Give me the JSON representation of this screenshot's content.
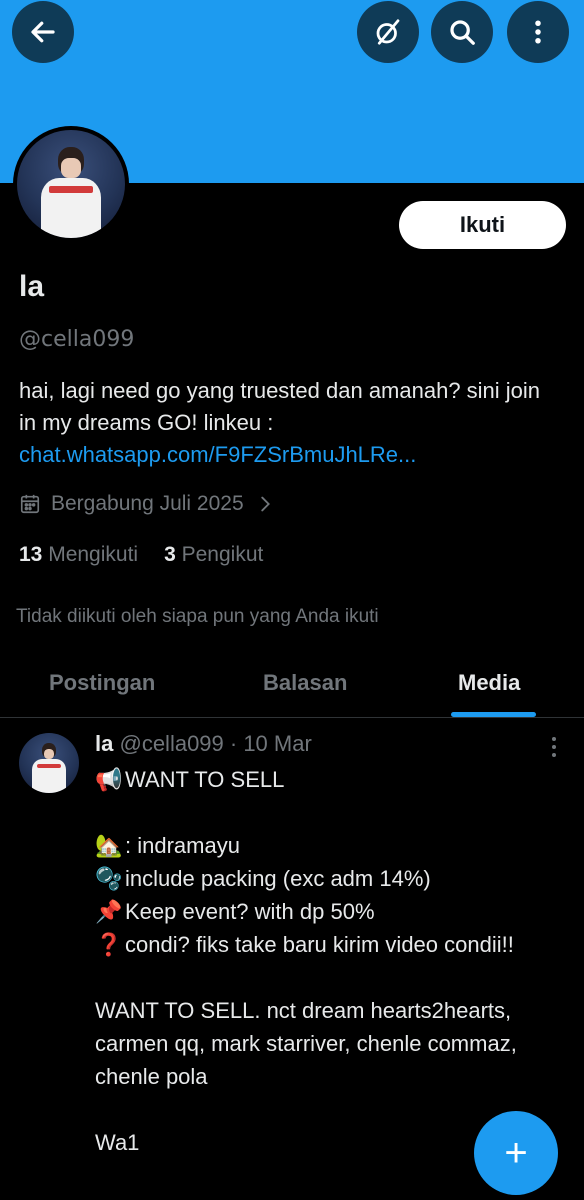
{
  "header": {
    "back_icon": "arrow-left-icon",
    "grok_icon": "grok-icon",
    "search_icon": "search-icon",
    "more_icon": "more-vertical-icon",
    "banner_color": "#1d9bf0"
  },
  "profile": {
    "follow_label": "Ikuti",
    "display_name": "la",
    "handle": "@cella099",
    "bio_text": "hai, lagi need go yang truested dan amanah? sini join in my dreams GO!  linkeu :",
    "bio_link": "chat.whatsapp.com/F9FZSrBmuJhLRe...",
    "joined": "Bergabung Juli 2025",
    "following_count": "13",
    "following_label": "Mengikuti",
    "followers_count": "3",
    "followers_label": "Pengikut",
    "not_followed_text": "Tidak diikuti oleh siapa pun yang Anda ikuti"
  },
  "tabs": [
    {
      "label": "Postingan"
    },
    {
      "label": "Balasan"
    },
    {
      "label": "Media",
      "active": true
    }
  ],
  "post": {
    "name": "la",
    "meta": "@cella099 · 10 Mar",
    "lines": [
      {
        "emoji": "📢",
        "text": "WANT TO SELL"
      },
      {
        "emoji": "",
        "text": ""
      },
      {
        "emoji": "🏡",
        "text": ": indramayu"
      },
      {
        "emoji": "🫧",
        "text": "include packing (exc adm 14%)"
      },
      {
        "emoji": "📌",
        "text": "Keep event? with dp 50%"
      },
      {
        "emoji": "❓",
        "text": "condi? fiks take baru kirim video condii!!"
      },
      {
        "emoji": "",
        "text": ""
      },
      {
        "emoji": "",
        "text": "WANT TO SELL. nct dream hearts2hearts, carmen qq, mark starriver, chenle commaz, chenle pola"
      },
      {
        "emoji": "",
        "text": ""
      },
      {
        "emoji": "",
        "text": "Wa1"
      }
    ]
  },
  "fab": {
    "label": "+",
    "icon": "plus-icon",
    "color": "#1d9bf0"
  }
}
